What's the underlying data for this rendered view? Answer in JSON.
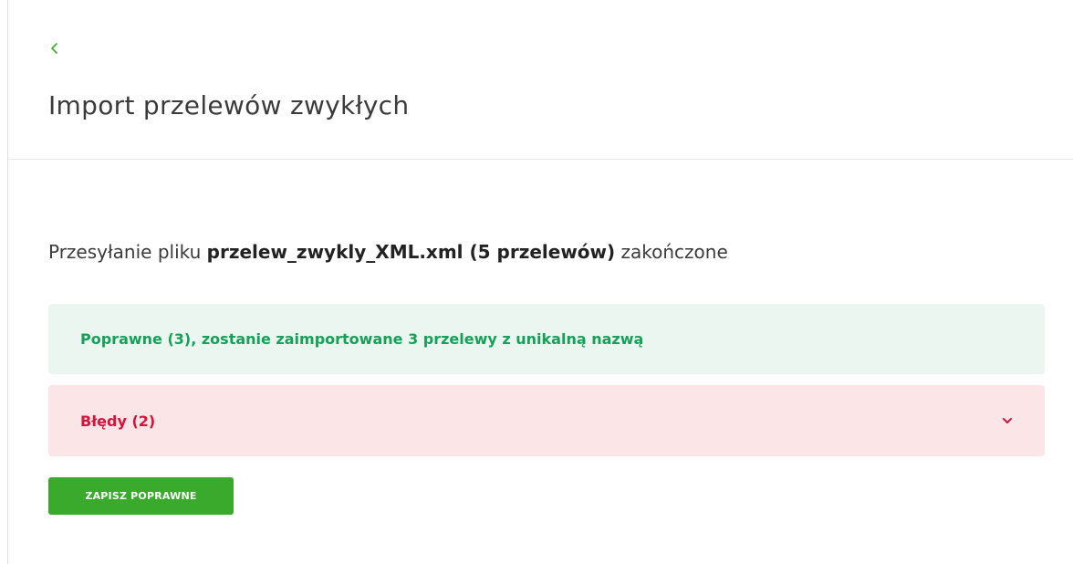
{
  "header": {
    "title": "Import przelewów zwykłych",
    "back_icon": "chevron-left-icon"
  },
  "upload": {
    "prefix": "Przesyłanie pliku",
    "file_info": "przelew_zwykly_XML.xml (5 przelewów)",
    "suffix": "zakończone"
  },
  "results": {
    "success_message": "Poprawne (3), zostanie zaimportowane 3 przelewy z unikalną nazwą",
    "errors_label": "Błędy (2)",
    "errors_icon": "chevron-down-icon"
  },
  "actions": {
    "save_label": "ZAPISZ POPRAWNE"
  },
  "colors": {
    "accent": "#3aaa2d",
    "success_text": "#17a05a",
    "success_bg": "#eaf6ef",
    "error_text": "#d4143a",
    "error_bg": "#fbe5e6"
  }
}
